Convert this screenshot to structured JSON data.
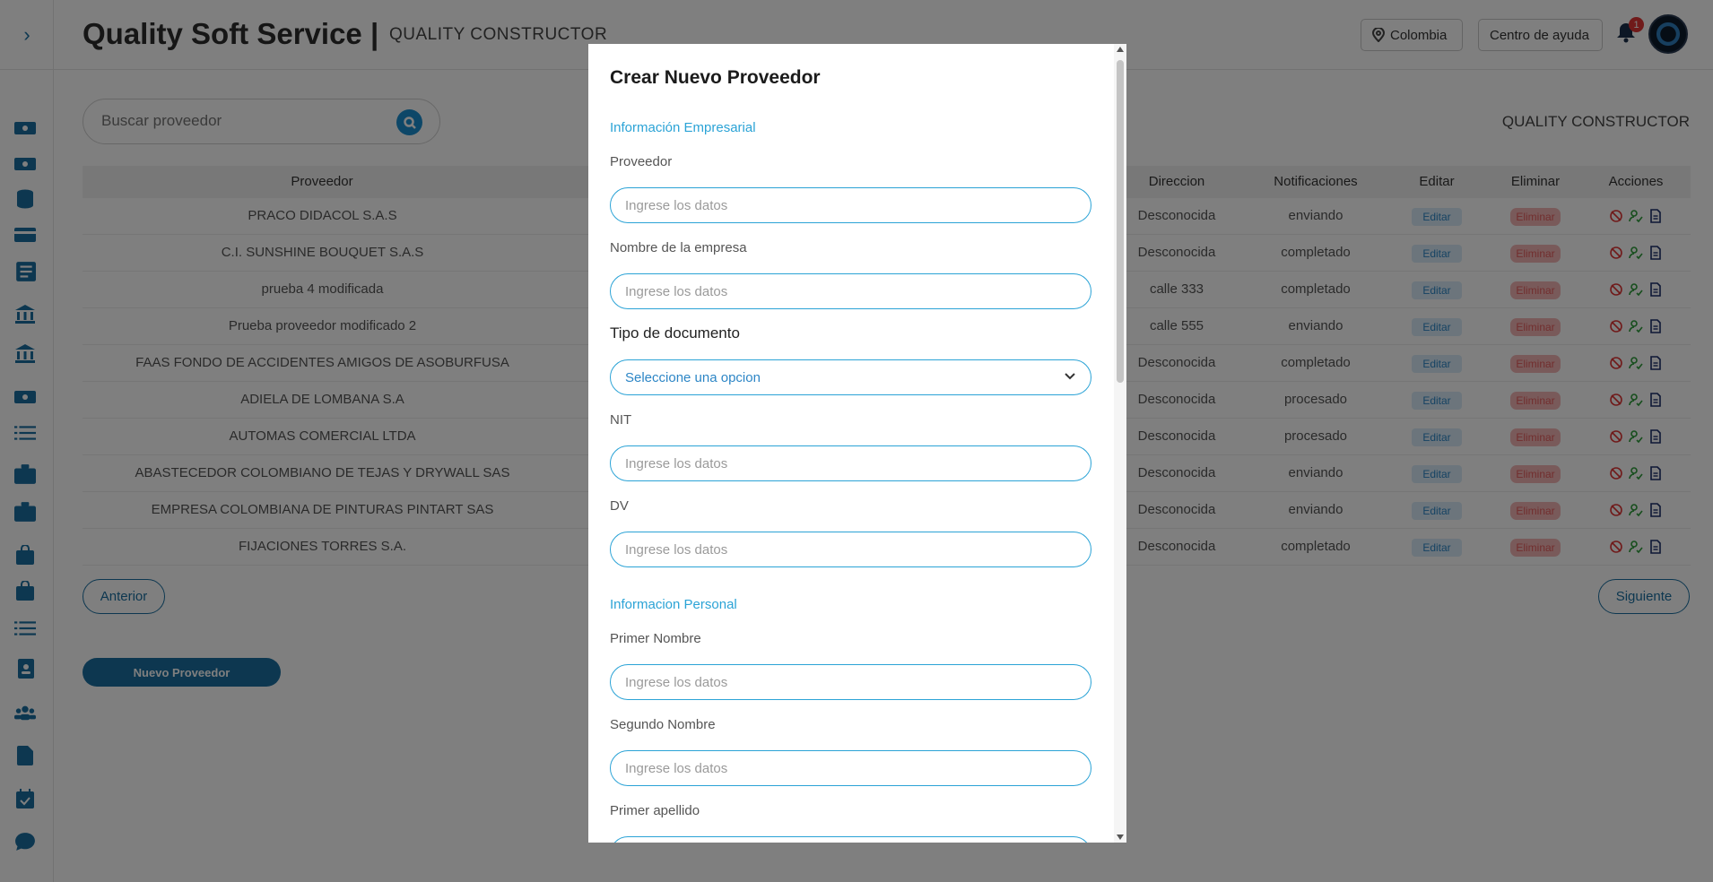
{
  "header": {
    "brand": "Quality Soft Service |",
    "company": "QUALITY CONSTRUCTOR",
    "country_label": "Colombia",
    "help_label": "Centro de ayuda",
    "notification_count": "1"
  },
  "search": {
    "placeholder": "Buscar proveedor"
  },
  "company_right": "QUALITY CONSTRUCTOR",
  "table": {
    "columns": [
      "Proveedor",
      "Direccion",
      "Notificaciones",
      "Editar",
      "Eliminar",
      "Acciones"
    ],
    "rows": [
      {
        "proveedor": "PRACO DIDACOL S.A.S",
        "direccion": "Desconocida",
        "notificaciones": "enviando"
      },
      {
        "proveedor": "C.I. SUNSHINE BOUQUET S.A.S",
        "direccion": "Desconocida",
        "notificaciones": "completado"
      },
      {
        "proveedor": "prueba 4 modificada",
        "direccion": "calle 333",
        "notificaciones": "completado"
      },
      {
        "proveedor": "Prueba proveedor modificado 2",
        "direccion": "calle 555",
        "notificaciones": "enviando"
      },
      {
        "proveedor": "FAAS FONDO DE ACCIDENTES AMIGOS DE ASOBURFUSA",
        "direccion": "Desconocida",
        "notificaciones": "completado"
      },
      {
        "proveedor": "ADIELA DE LOMBANA S.A",
        "direccion": "Desconocida",
        "notificaciones": "procesado"
      },
      {
        "proveedor": "AUTOMAS COMERCIAL LTDA",
        "direccion": "Desconocida",
        "notificaciones": "procesado"
      },
      {
        "proveedor": "ABASTECEDOR COLOMBIANO DE TEJAS Y DRYWALL SAS",
        "direccion": "Desconocida",
        "notificaciones": "enviando"
      },
      {
        "proveedor": "EMPRESA COLOMBIANA DE PINTURAS PINTART SAS",
        "direccion": "Desconocida",
        "notificaciones": "enviando"
      },
      {
        "proveedor": "FIJACIONES TORRES S.A.",
        "direccion": "Desconocida",
        "notificaciones": "completado"
      }
    ],
    "edit_label": "Editar",
    "delete_label": "Eliminar"
  },
  "pagination": {
    "prev_label": "Anterior",
    "next_label": "Siguiente"
  },
  "new_button_label": "Nuevo Proveedor",
  "modal": {
    "title": "Crear Nuevo Proveedor",
    "section_business": "Información Empresarial",
    "section_personal": "Informacion Personal",
    "input_placeholder": "Ingrese los datos",
    "select_placeholder": "Seleccione una opcion",
    "labels": {
      "proveedor": "Proveedor",
      "empresa": "Nombre de la empresa",
      "tipo_documento": "Tipo de documento",
      "nit": "NIT",
      "dv": "DV",
      "primer_nombre": "Primer Nombre",
      "segundo_nombre": "Segundo Nombre",
      "primer_apellido": "Primer apellido"
    }
  },
  "colors": {
    "primary": "#1a6fa0",
    "accent": "#2ba3d6",
    "danger": "#e35c5c"
  }
}
